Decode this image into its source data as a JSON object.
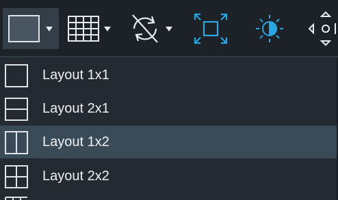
{
  "toolbar": {
    "buttons": [
      {
        "name": "layout-dropdown-button",
        "icon": "layout-square-icon",
        "has_dropdown": true,
        "active": true
      },
      {
        "name": "grid-dropdown-button",
        "icon": "grid-icon",
        "has_dropdown": true,
        "active": false
      },
      {
        "name": "sync-dropdown-button",
        "icon": "sync-off-icon",
        "has_dropdown": true,
        "active": false
      },
      {
        "name": "fit-to-screen-button",
        "icon": "fit-screen-icon",
        "has_dropdown": false,
        "active": false
      },
      {
        "name": "brightness-contrast-button",
        "icon": "contrast-icon",
        "has_dropdown": false,
        "active": false
      },
      {
        "name": "pan-button",
        "icon": "pan-arrows-icon",
        "has_dropdown": false,
        "active": false
      }
    ],
    "colors": {
      "background": "#1c2228",
      "icon": "#e8edf0",
      "accent": "#2aa7e0"
    }
  },
  "layout_menu": {
    "items": [
      {
        "label": "Layout 1x1",
        "icon": "layout-1x1-icon",
        "selected": false
      },
      {
        "label": "Layout 2x1",
        "icon": "layout-2x1-icon",
        "selected": false
      },
      {
        "label": "Layout 1x2",
        "icon": "layout-1x2-icon",
        "selected": true
      },
      {
        "label": "Layout 2x2",
        "icon": "layout-2x2-icon",
        "selected": false
      }
    ],
    "colors": {
      "background": "#232a31",
      "selected": "#3b4a57",
      "text": "#eef2f5"
    }
  }
}
